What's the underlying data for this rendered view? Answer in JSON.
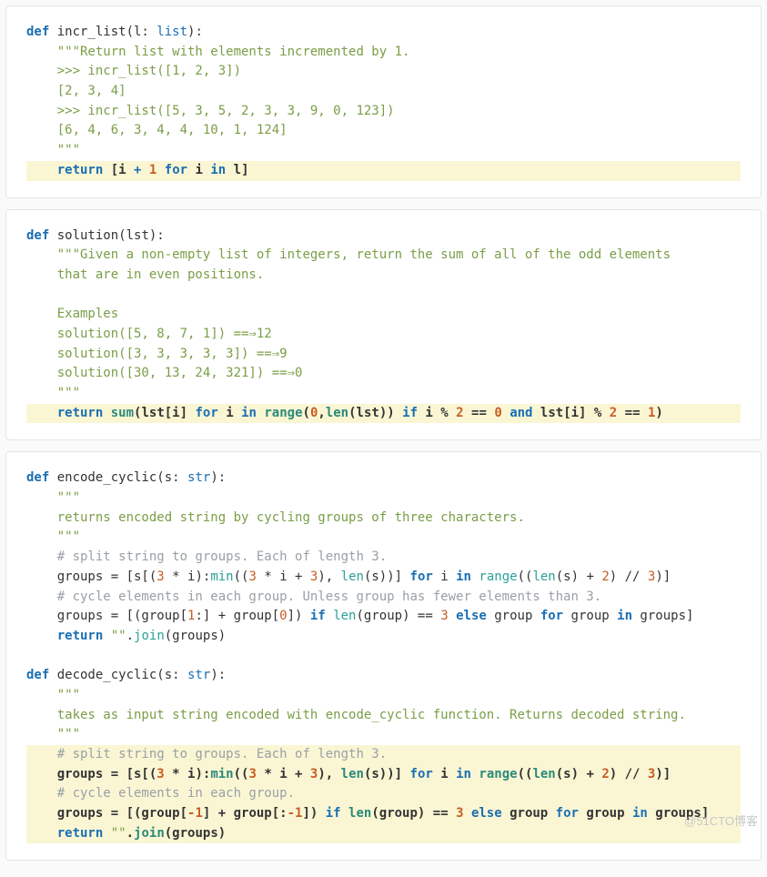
{
  "watermark": "@51CTO博客",
  "blocks": [
    {
      "id": "incr_list",
      "lines": [
        {
          "hl": false,
          "tokens": [
            [
              "k",
              "def "
            ],
            [
              "fn",
              "incr_list"
            ],
            [
              "n",
              "(l: "
            ],
            [
              "kb",
              "list"
            ],
            [
              "n",
              "):"
            ]
          ]
        },
        {
          "hl": false,
          "tokens": [
            [
              "n",
              "    "
            ],
            [
              "s",
              "\"\"\"Return list with elements incremented by 1."
            ]
          ]
        },
        {
          "hl": false,
          "tokens": [
            [
              "n",
              "    "
            ],
            [
              "s",
              ">>> incr_list([1, 2, 3])"
            ]
          ]
        },
        {
          "hl": false,
          "tokens": [
            [
              "n",
              "    "
            ],
            [
              "s",
              "[2, 3, 4]"
            ]
          ]
        },
        {
          "hl": false,
          "tokens": [
            [
              "n",
              "    "
            ],
            [
              "s",
              ">>> incr_list([5, 3, 5, 2, 3, 3, 9, 0, 123])"
            ]
          ]
        },
        {
          "hl": false,
          "tokens": [
            [
              "n",
              "    "
            ],
            [
              "s",
              "[6, 4, 6, 3, 4, 4, 10, 1, 124]"
            ]
          ]
        },
        {
          "hl": false,
          "tokens": [
            [
              "n",
              "    "
            ],
            [
              "s",
              "\"\"\""
            ]
          ]
        },
        {
          "hl": true,
          "tokens": [
            [
              "n",
              "    "
            ],
            [
              "k",
              "return"
            ],
            [
              "n",
              " [i "
            ],
            [
              "k",
              "+"
            ],
            [
              "n",
              " "
            ],
            [
              "num",
              "1"
            ],
            [
              "n",
              " "
            ],
            [
              "k",
              "for"
            ],
            [
              "n",
              " i "
            ],
            [
              "k",
              "in"
            ],
            [
              "n",
              " l]"
            ]
          ]
        }
      ]
    },
    {
      "id": "solution",
      "lines": [
        {
          "hl": false,
          "tokens": [
            [
              "k",
              "def "
            ],
            [
              "fn",
              "solution"
            ],
            [
              "n",
              "(lst):"
            ]
          ]
        },
        {
          "hl": false,
          "tokens": [
            [
              "n",
              "    "
            ],
            [
              "s",
              "\"\"\"Given a non-empty list of integers, return the sum of all of the odd elements"
            ]
          ]
        },
        {
          "hl": false,
          "tokens": [
            [
              "n",
              "    "
            ],
            [
              "s",
              "that are in even positions."
            ]
          ]
        },
        {
          "hl": false,
          "tokens": [
            [
              "n",
              "    "
            ]
          ]
        },
        {
          "hl": false,
          "tokens": [
            [
              "n",
              "    "
            ],
            [
              "s",
              "Examples"
            ]
          ]
        },
        {
          "hl": false,
          "tokens": [
            [
              "n",
              "    "
            ],
            [
              "s",
              "solution([5, 8, 7, 1]) ==⇒12"
            ]
          ]
        },
        {
          "hl": false,
          "tokens": [
            [
              "n",
              "    "
            ],
            [
              "s",
              "solution([3, 3, 3, 3, 3]) ==⇒9"
            ]
          ]
        },
        {
          "hl": false,
          "tokens": [
            [
              "n",
              "    "
            ],
            [
              "s",
              "solution([30, 13, 24, 321]) ==⇒0"
            ]
          ]
        },
        {
          "hl": false,
          "tokens": [
            [
              "n",
              "    "
            ],
            [
              "s",
              "\"\"\""
            ]
          ]
        },
        {
          "hl": true,
          "tokens": [
            [
              "n",
              "    "
            ],
            [
              "k",
              "return"
            ],
            [
              "n",
              " "
            ],
            [
              "bi",
              "sum"
            ],
            [
              "n",
              "(lst[i] "
            ],
            [
              "k",
              "for"
            ],
            [
              "n",
              " i "
            ],
            [
              "k",
              "in"
            ],
            [
              "n",
              " "
            ],
            [
              "bi",
              "range"
            ],
            [
              "n",
              "("
            ],
            [
              "num",
              "0"
            ],
            [
              "n",
              ","
            ],
            [
              "bi",
              "len"
            ],
            [
              "n",
              "(lst)) "
            ],
            [
              "k",
              "if"
            ],
            [
              "n",
              " i % "
            ],
            [
              "num",
              "2"
            ],
            [
              "n",
              " == "
            ],
            [
              "num",
              "0"
            ],
            [
              "n",
              " "
            ],
            [
              "k",
              "and"
            ],
            [
              "n",
              " lst[i] % "
            ],
            [
              "num",
              "2"
            ],
            [
              "n",
              " == "
            ],
            [
              "num",
              "1"
            ],
            [
              "n",
              ")"
            ]
          ]
        }
      ]
    },
    {
      "id": "cyclic",
      "lines": [
        {
          "hl": false,
          "tokens": [
            [
              "k",
              "def "
            ],
            [
              "fn",
              "encode_cyclic"
            ],
            [
              "n",
              "(s: "
            ],
            [
              "kb",
              "str"
            ],
            [
              "n",
              "):"
            ]
          ]
        },
        {
          "hl": false,
          "tokens": [
            [
              "n",
              "    "
            ],
            [
              "s",
              "\"\"\""
            ]
          ]
        },
        {
          "hl": false,
          "tokens": [
            [
              "n",
              "    "
            ],
            [
              "s",
              "returns encoded string by cycling groups of three characters."
            ]
          ]
        },
        {
          "hl": false,
          "tokens": [
            [
              "n",
              "    "
            ],
            [
              "s",
              "\"\"\""
            ]
          ]
        },
        {
          "hl": false,
          "tokens": [
            [
              "n",
              "    "
            ],
            [
              "cm",
              "# split string to groups. Each of length 3."
            ]
          ]
        },
        {
          "hl": false,
          "tokens": [
            [
              "n",
              "    groups = [s[("
            ],
            [
              "num",
              "3"
            ],
            [
              "n",
              " * i):"
            ],
            [
              "bi",
              "min"
            ],
            [
              "n",
              "(("
            ],
            [
              "num",
              "3"
            ],
            [
              "n",
              " * i + "
            ],
            [
              "num",
              "3"
            ],
            [
              "n",
              "), "
            ],
            [
              "bi",
              "len"
            ],
            [
              "n",
              "(s))] "
            ],
            [
              "k",
              "for"
            ],
            [
              "n",
              " i "
            ],
            [
              "k",
              "in"
            ],
            [
              "n",
              " "
            ],
            [
              "bi",
              "range"
            ],
            [
              "n",
              "(("
            ],
            [
              "bi",
              "len"
            ],
            [
              "n",
              "(s) + "
            ],
            [
              "num",
              "2"
            ],
            [
              "n",
              ") // "
            ],
            [
              "num",
              "3"
            ],
            [
              "n",
              ")]"
            ]
          ]
        },
        {
          "hl": false,
          "tokens": [
            [
              "n",
              "    "
            ],
            [
              "cm",
              "# cycle elements in each group. Unless group has fewer elements than 3."
            ]
          ]
        },
        {
          "hl": false,
          "tokens": [
            [
              "n",
              "    groups = [(group["
            ],
            [
              "num",
              "1"
            ],
            [
              "n",
              ":] + group["
            ],
            [
              "num",
              "0"
            ],
            [
              "n",
              "]) "
            ],
            [
              "k",
              "if"
            ],
            [
              "n",
              " "
            ],
            [
              "bi",
              "len"
            ],
            [
              "n",
              "(group) == "
            ],
            [
              "num",
              "3"
            ],
            [
              "n",
              " "
            ],
            [
              "k",
              "else"
            ],
            [
              "n",
              " group "
            ],
            [
              "k",
              "for"
            ],
            [
              "n",
              " group "
            ],
            [
              "k",
              "in"
            ],
            [
              "n",
              " groups]"
            ]
          ]
        },
        {
          "hl": false,
          "tokens": [
            [
              "n",
              "    "
            ],
            [
              "k",
              "return"
            ],
            [
              "n",
              " "
            ],
            [
              "s",
              "\"\""
            ],
            [
              "n",
              "."
            ],
            [
              "bi",
              "join"
            ],
            [
              "n",
              "(groups)"
            ]
          ]
        },
        {
          "hl": false,
          "tokens": [
            [
              "n",
              " "
            ]
          ]
        },
        {
          "hl": false,
          "tokens": [
            [
              "k",
              "def "
            ],
            [
              "fn",
              "decode_cyclic"
            ],
            [
              "n",
              "(s: "
            ],
            [
              "kb",
              "str"
            ],
            [
              "n",
              "):"
            ]
          ]
        },
        {
          "hl": false,
          "tokens": [
            [
              "n",
              "    "
            ],
            [
              "s",
              "\"\"\""
            ]
          ]
        },
        {
          "hl": false,
          "tokens": [
            [
              "n",
              "    "
            ],
            [
              "s",
              "takes as input string encoded with encode_cyclic function. Returns decoded string."
            ]
          ]
        },
        {
          "hl": false,
          "tokens": [
            [
              "n",
              "    "
            ],
            [
              "s",
              "\"\"\""
            ]
          ]
        },
        {
          "hl": true,
          "tokens": [
            [
              "n",
              "    "
            ],
            [
              "cm",
              "# split string to groups. Each of length 3."
            ]
          ]
        },
        {
          "hl": true,
          "tokens": [
            [
              "n",
              "    groups = [s[("
            ],
            [
              "num",
              "3"
            ],
            [
              "n",
              " * i):"
            ],
            [
              "bi",
              "min"
            ],
            [
              "n",
              "(("
            ],
            [
              "num",
              "3"
            ],
            [
              "n",
              " * i + "
            ],
            [
              "num",
              "3"
            ],
            [
              "n",
              "), "
            ],
            [
              "bi",
              "len"
            ],
            [
              "n",
              "(s))] "
            ],
            [
              "k",
              "for"
            ],
            [
              "n",
              " i "
            ],
            [
              "k",
              "in"
            ],
            [
              "n",
              " "
            ],
            [
              "bi",
              "range"
            ],
            [
              "n",
              "(("
            ],
            [
              "bi",
              "len"
            ],
            [
              "n",
              "(s) + "
            ],
            [
              "num",
              "2"
            ],
            [
              "n",
              ") // "
            ],
            [
              "num",
              "3"
            ],
            [
              "n",
              ")]"
            ]
          ]
        },
        {
          "hl": true,
          "tokens": [
            [
              "n",
              "    "
            ],
            [
              "cm",
              "# cycle elements in each group."
            ]
          ]
        },
        {
          "hl": true,
          "tokens": [
            [
              "n",
              "    groups = [(group["
            ],
            [
              "num",
              "-1"
            ],
            [
              "n",
              "] + group[:"
            ],
            [
              "num",
              "-1"
            ],
            [
              "n",
              "]) "
            ],
            [
              "k",
              "if"
            ],
            [
              "n",
              " "
            ],
            [
              "bi",
              "len"
            ],
            [
              "n",
              "(group) == "
            ],
            [
              "num",
              "3"
            ],
            [
              "n",
              " "
            ],
            [
              "k",
              "else"
            ],
            [
              "n",
              " group "
            ],
            [
              "k",
              "for"
            ],
            [
              "n",
              " group "
            ],
            [
              "k",
              "in"
            ],
            [
              "n",
              " groups]"
            ]
          ]
        },
        {
          "hl": true,
          "tokens": [
            [
              "n",
              "    "
            ],
            [
              "k",
              "return"
            ],
            [
              "n",
              " "
            ],
            [
              "s",
              "\"\""
            ],
            [
              "n",
              "."
            ],
            [
              "bi",
              "join"
            ],
            [
              "n",
              "(groups)"
            ]
          ]
        }
      ]
    }
  ]
}
